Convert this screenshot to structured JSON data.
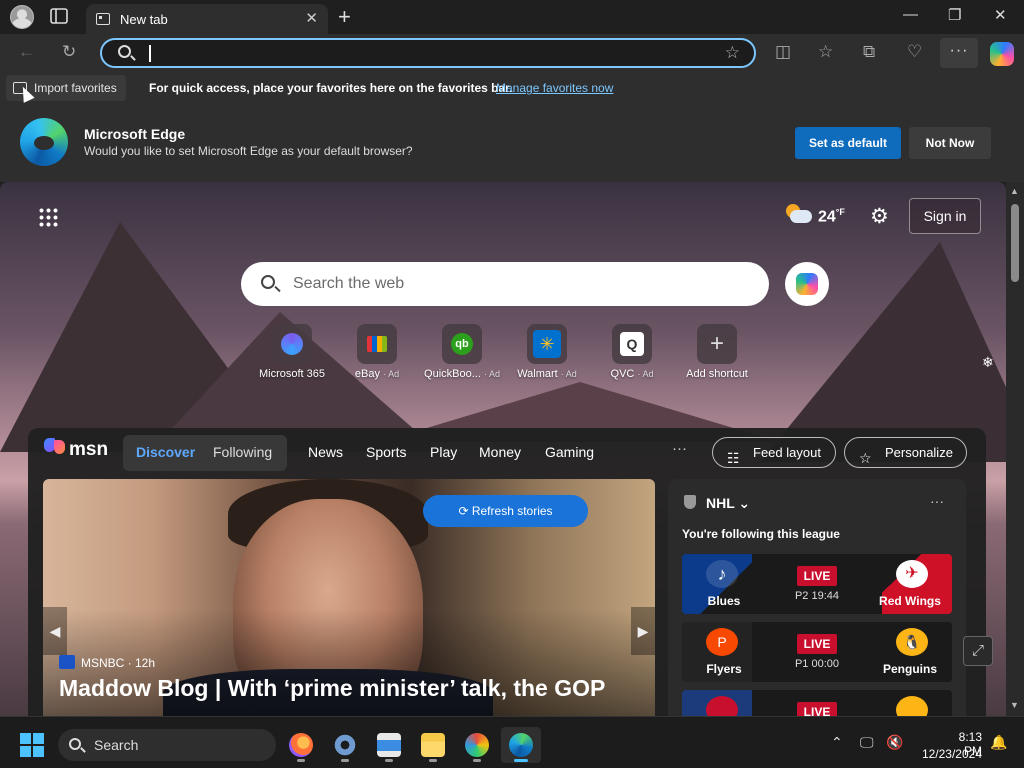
{
  "browser": {
    "tab_title": "New tab",
    "tab_close": "✕",
    "new_tab": "+",
    "window_controls": {
      "minimize": "—",
      "maximize": "❐",
      "close": "✕"
    },
    "omnibox": {
      "value": ""
    },
    "toolbar_icons": {
      "back": "←",
      "refresh": "↻",
      "split": "◫",
      "favorites": "☆",
      "collections": "⧉",
      "performance": "♡",
      "more": "···"
    }
  },
  "favorites_bar": {
    "import_label": "Import favorites",
    "message": "For quick access, place your favorites here on the favorites bar.",
    "link": "Manage favorites now"
  },
  "banner": {
    "title": "Microsoft Edge",
    "subtitle": "Would you like to set Microsoft Edge as your default browser?",
    "primary_button": "Set as default",
    "secondary_button": "Not Now"
  },
  "newtab": {
    "weather_temp": "24",
    "weather_unit": "°F",
    "sign_in": "Sign in",
    "search_placeholder": "Search the web",
    "quick_links": [
      {
        "label": "Microsoft 365",
        "ad": ""
      },
      {
        "label": "eBay",
        "ad": "· Ad"
      },
      {
        "label": "QuickBoo...",
        "ad": "· Ad"
      },
      {
        "label": "Walmart",
        "ad": "· Ad"
      },
      {
        "label": "QVC",
        "ad": "· Ad"
      },
      {
        "label": "Add shortcut",
        "ad": ""
      }
    ]
  },
  "feed": {
    "brand": "msn",
    "tabs": {
      "discover": "Discover",
      "following": "Following"
    },
    "nav": [
      "News",
      "Sports",
      "Play",
      "Money",
      "Gaming"
    ],
    "more": "···",
    "feed_layout": "Feed layout",
    "personalize": "Personalize",
    "refresh": "Refresh stories",
    "hero": {
      "source": "MSNBC · 12h",
      "headline": "Maddow Blog | With ‘prime minister’ talk, the GOP"
    },
    "nhl": {
      "title": "NHL",
      "subtitle": "You're following this league",
      "games": [
        {
          "home": "Blues",
          "away": "Red Wings",
          "status": "LIVE",
          "clock": "P2 19:44",
          "home_color": "#0d3b8c",
          "away_color": "#ce1126"
        },
        {
          "home": "Flyers",
          "away": "Penguins",
          "status": "LIVE",
          "clock": "P1 00:00",
          "home_color": "#2a2a2a",
          "away_color": "#1a1a1a"
        },
        {
          "home": "",
          "away": "",
          "status": "LIVE",
          "clock": "",
          "home_color": "#1c3b7a",
          "away_color": "#222222"
        }
      ]
    }
  },
  "taskbar": {
    "search_label": "Search",
    "time": "8:13 PM",
    "date": "12/23/2024",
    "apps": [
      "firefox",
      "settings",
      "printer",
      "file-explorer",
      "paint",
      "edge"
    ]
  }
}
